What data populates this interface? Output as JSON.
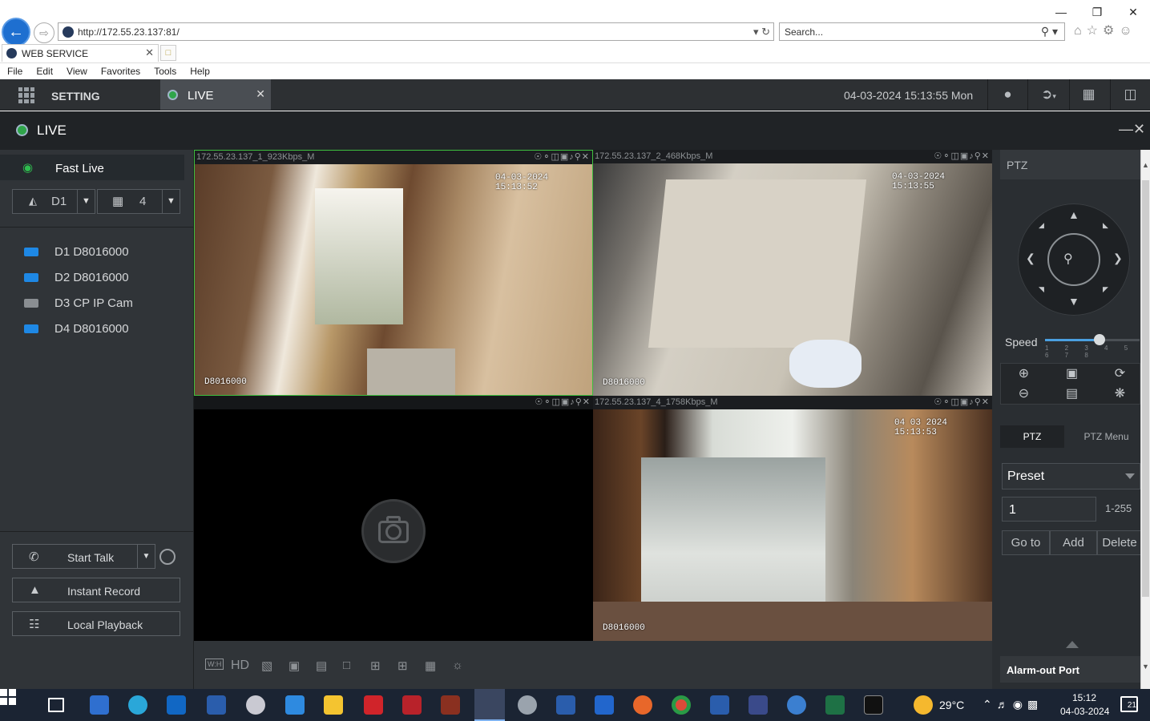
{
  "browser": {
    "url": "http://172.55.23.137:81/",
    "search_placeholder": "Search...",
    "tab_title": "WEB SERVICE",
    "menu": [
      "File",
      "Edit",
      "View",
      "Favorites",
      "Tools",
      "Help"
    ]
  },
  "app": {
    "setting_label": "SETTING",
    "live_tab_label": "LIVE",
    "datetime": "04-03-2024 15:13:55 Mon",
    "live_title": "LIVE"
  },
  "left": {
    "fast_live_label": "Fast Live",
    "device_select": "D1",
    "split_select": "4",
    "devices": [
      {
        "label": "D1 D8016000",
        "online": true
      },
      {
        "label": "D2 D8016000",
        "online": true
      },
      {
        "label": "D3 CP IP Cam",
        "online": false
      },
      {
        "label": "D4 D8016000",
        "online": true
      }
    ],
    "start_talk_label": "Start Talk",
    "instant_record_label": "Instant Record",
    "local_playback_label": "Local Playback"
  },
  "panes": [
    {
      "title": "172.55.23.137_1_923Kbps_M",
      "osd_time": "04-03-2024 15:13:52",
      "osd_name": "D8016000"
    },
    {
      "title": "172.55.23.137_2_468Kbps_M",
      "osd_time": "04-03-2024 15:13:55",
      "osd_name": "D8016000"
    },
    {
      "title": "",
      "osd_time": "",
      "osd_name": ""
    },
    {
      "title": "172.55.23.137_4_1758Kbps_M",
      "osd_time": "04 03 2024 15:13:53",
      "osd_name": "D8016000"
    }
  ],
  "video_toolbar": {
    "hd_label": "HD",
    "wh_label": "W:H"
  },
  "ptz": {
    "header": "PTZ",
    "speed_label": "Speed",
    "speed_value": 5,
    "speed_max": 8,
    "speed_ticks": "1 2 3 4 5 6 7 8",
    "tab_ptz": "PTZ",
    "tab_ptz_menu": "PTZ Menu",
    "preset_select": "Preset",
    "preset_value": "1",
    "preset_range": "1-255",
    "goto_label": "Go to",
    "add_label": "Add",
    "delete_label": "Delete",
    "alarm_out_label": "Alarm-out Port"
  },
  "taskbar": {
    "temperature": "29°C",
    "time": "15:12",
    "date": "04-03-2024",
    "notifications": "21"
  }
}
